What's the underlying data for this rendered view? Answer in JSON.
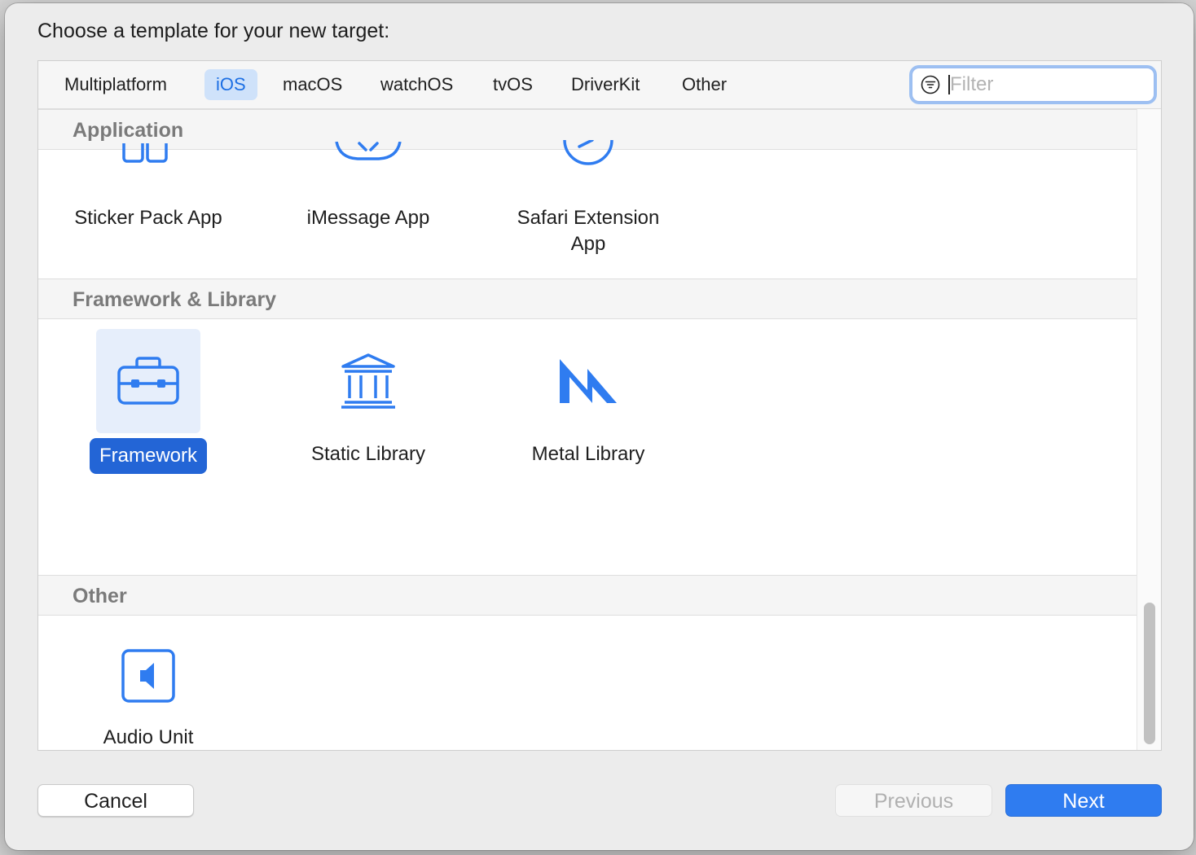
{
  "dialog": {
    "title": "Choose a template for your new target:"
  },
  "tabs": [
    {
      "label": "Multiplatform",
      "selected": false
    },
    {
      "label": "iOS",
      "selected": true
    },
    {
      "label": "macOS",
      "selected": false
    },
    {
      "label": "watchOS",
      "selected": false
    },
    {
      "label": "tvOS",
      "selected": false
    },
    {
      "label": "DriverKit",
      "selected": false
    },
    {
      "label": "Other",
      "selected": false
    }
  ],
  "filter": {
    "placeholder": "Filter",
    "value": ""
  },
  "sections": [
    {
      "header": "Application",
      "items": [
        {
          "label": "Sticker Pack App",
          "icon": "sticker-pack-icon",
          "selected": false
        },
        {
          "label": "iMessage App",
          "icon": "imessage-icon",
          "selected": false
        },
        {
          "label": "Safari Extension App",
          "icon": "safari-compass-icon",
          "selected": false
        }
      ]
    },
    {
      "header": "Framework & Library",
      "items": [
        {
          "label": "Framework",
          "icon": "toolbox-icon",
          "selected": true
        },
        {
          "label": "Static Library",
          "icon": "library-building-icon",
          "selected": false
        },
        {
          "label": "Metal Library",
          "icon": "metal-icon",
          "selected": false
        }
      ]
    },
    {
      "header": "Other",
      "items": [
        {
          "label": "Audio Unit Extension App",
          "icon": "audio-unit-icon",
          "selected": false
        }
      ]
    }
  ],
  "buttons": {
    "cancel": "Cancel",
    "previous": "Previous",
    "next": "Next"
  },
  "colors": {
    "accent": "#2f7cf0",
    "selection": "#2365d6",
    "icon_blue": "#2f7cf0"
  }
}
